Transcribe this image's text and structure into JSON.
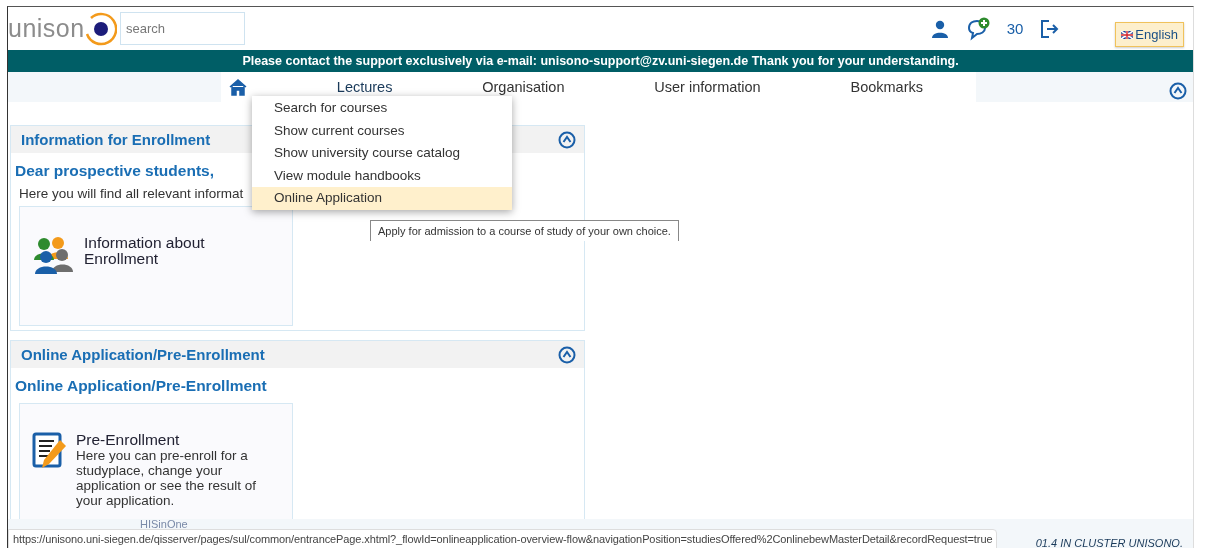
{
  "header": {
    "logo_text": "unison",
    "search": {
      "placeholder": "search"
    },
    "count": "30",
    "language_button": "English"
  },
  "banner": "Please contact the support exclusively via e-mail: unisono-support@zv.uni-siegen.de Thank you for your understanding.",
  "nav": {
    "items": [
      {
        "label": "Lectures",
        "expanded": true
      },
      {
        "label": "Organisation",
        "expanded": false
      },
      {
        "label": "User information",
        "expanded": false
      },
      {
        "label": "Bookmarks",
        "expanded": false
      }
    ],
    "dropdown": [
      {
        "label": "Search for courses",
        "selected": false
      },
      {
        "label": "Show current courses",
        "selected": false
      },
      {
        "label": "Show university course catalog",
        "selected": false
      },
      {
        "label": "View module handbooks",
        "selected": false
      },
      {
        "label": "Online Application",
        "selected": true
      }
    ],
    "tooltip": "Apply for admission to a course of study of your own choice."
  },
  "panels": [
    {
      "title": "Information for Enrollment",
      "heading": "Dear prospective students,",
      "intro": "Here you will find all relevant informat",
      "tile": {
        "title": "Information about Enrollment"
      }
    },
    {
      "title": "Online Application/Pre-Enrollment",
      "heading": "Online Application/Pre-Enrollment",
      "tile": {
        "title": "Pre-Enrollment",
        "text": "Here you can pre-enroll for a studyplace, change your application or see the result of your application."
      }
    }
  ],
  "footer": {
    "logo": "HISinOne",
    "version": "01.4 IN CLUSTER UNISONO."
  },
  "status_url": "https://unisono.uni-siegen.de/qisserver/pages/sul/common/entrancePage.xhtml?_flowId=onlineapplication-overview-flow&navigationPosition=studiesOffered%2ConlinebewMasterDetail&recordRequest=true"
}
